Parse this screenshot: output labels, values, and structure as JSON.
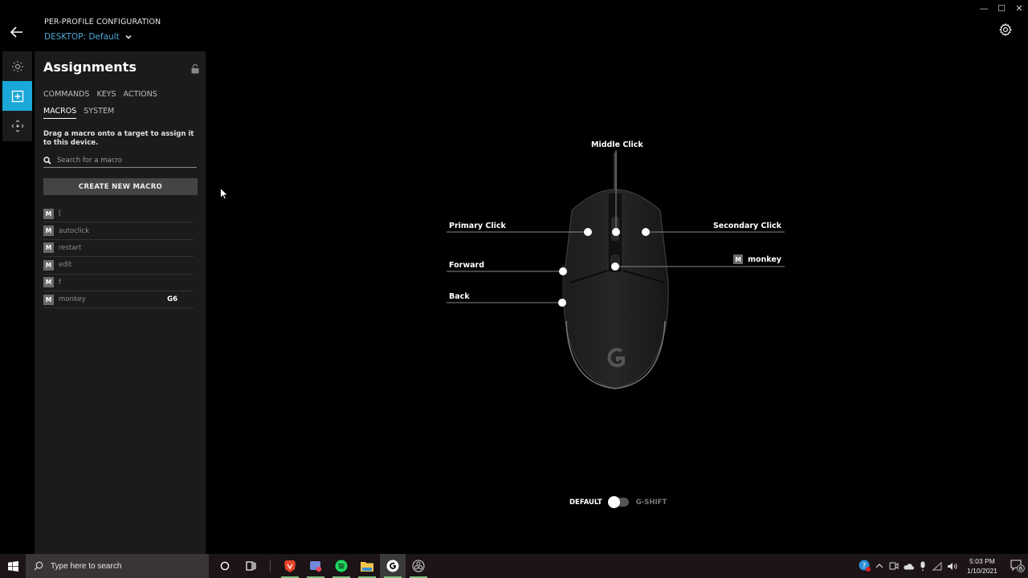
{
  "header": {
    "title": "PER-PROFILE CONFIGURATION",
    "profile": "DESKTOP: Default"
  },
  "window_controls": {
    "minimize": "—",
    "maximize": "☐",
    "close": "✕"
  },
  "rail": [
    {
      "name": "lighting",
      "icon": "sun-icon",
      "active": false
    },
    {
      "name": "assignments",
      "icon": "plus-square-icon",
      "active": true
    },
    {
      "name": "dpi",
      "icon": "move-arrows-icon",
      "active": false
    }
  ],
  "panel": {
    "title": "Assignments",
    "tabs_row1": [
      "COMMANDS",
      "KEYS",
      "ACTIONS"
    ],
    "tabs_row2": [
      "MACROS",
      "SYSTEM"
    ],
    "active_tab": "MACROS",
    "hint": "Drag a macro onto a target to assign it to this device.",
    "search_placeholder": "Search for a macro",
    "create_button": "CREATE NEW MACRO",
    "macro_badge": "M",
    "macros": [
      {
        "name": "[",
        "key": ""
      },
      {
        "name": "autoclick",
        "key": ""
      },
      {
        "name": "restart",
        "key": ""
      },
      {
        "name": "edit",
        "key": ""
      },
      {
        "name": "f",
        "key": ""
      },
      {
        "name": "monkey",
        "key": "G6"
      }
    ]
  },
  "mouse": {
    "callouts": {
      "middle": "Middle Click",
      "primary": "Primary Click",
      "secondary": "Secondary Click",
      "forward": "Forward",
      "back": "Back",
      "g6": "monkey",
      "g6_badge": "M"
    }
  },
  "mode_toggle": {
    "left": "DEFAULT",
    "right": "G-SHIFT",
    "selected": "DEFAULT"
  },
  "taskbar": {
    "search_placeholder": "Type here to search",
    "apps": [
      "cortana",
      "task-view",
      "brave",
      "discord",
      "spotify",
      "file-explorer",
      "logitech-g-hub",
      "obs"
    ],
    "time": "5:03 PM",
    "date": "1/10/2021",
    "notification_count": "6"
  }
}
